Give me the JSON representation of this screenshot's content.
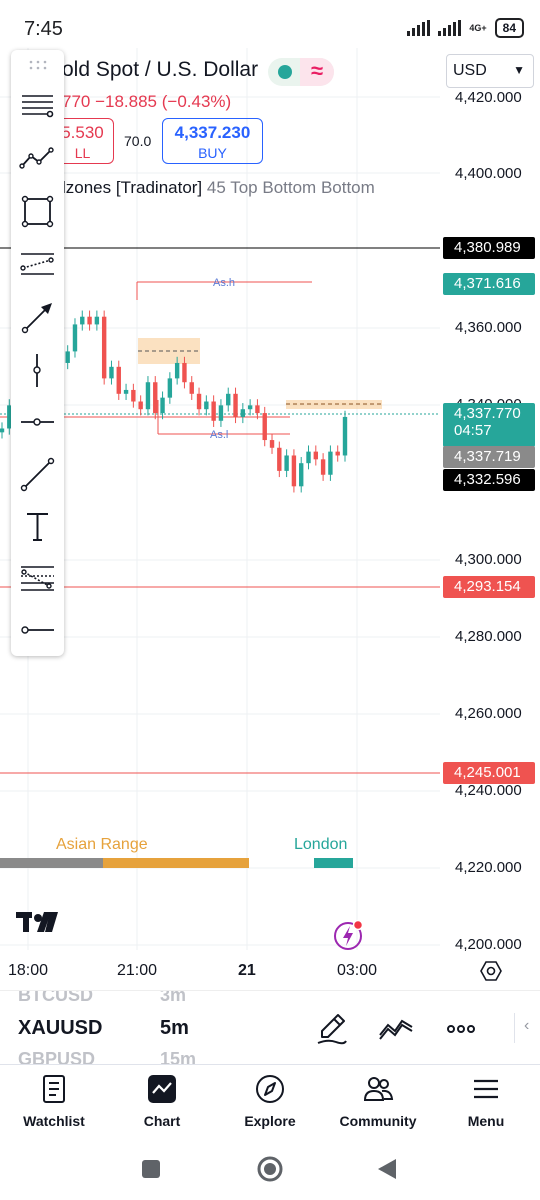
{
  "status_bar": {
    "time": "7:45",
    "network": "4G+",
    "battery": "84"
  },
  "header": {
    "symbol_title": "old Spot / U.S. Dollar",
    "change_text": "770  −18.885 (−0.43%)",
    "currency": "USD"
  },
  "trade": {
    "sell_price": "5.530",
    "sell_label": "LL",
    "spread": "70.0",
    "buy_price": "4,337.230",
    "buy_label": "BUY"
  },
  "indicator": {
    "name": "lzones [Tradinator]",
    "params": "45 Top Bottom Bottom"
  },
  "chart_annotations": {
    "asian_high": "As.h",
    "asian_low": "As.l"
  },
  "colors": {
    "up": "#26a69a",
    "down": "#ef5350",
    "grid": "#eef0f3",
    "zone": "#f8c98e",
    "asian_bar": "#e6a23c",
    "london": "#26a69a",
    "range_gray": "#8a8a8a"
  },
  "price_axis": {
    "ticks": [
      "4,420.000",
      "4,400.000",
      "4,360.000",
      "4,340.000",
      "4,300.000",
      "4,280.000",
      "4,260.000",
      "4,240.000",
      "4,220.000",
      "4,200.000"
    ],
    "tags": [
      {
        "text": "4,380.989",
        "bg": "#000000"
      },
      {
        "text": "4,371.616",
        "bg": "#26a69a"
      },
      {
        "text": "4,337.770",
        "sub": "04:57",
        "bg": "#26a69a"
      },
      {
        "text": "4,337.719",
        "bg": "#8a8a8a"
      },
      {
        "text": "4,332.596",
        "bg": "#000000"
      },
      {
        "text": "4,293.154",
        "bg": "#ef5350"
      },
      {
        "text": "4,245.001",
        "bg": "#ef5350"
      }
    ]
  },
  "sessions": {
    "asian": "Asian Range",
    "london": "London"
  },
  "time_axis": {
    "ticks": [
      "18:00",
      "21:00",
      "21",
      "03:00"
    ]
  },
  "chart_data": {
    "type": "candlestick",
    "x": [
      "18:00",
      "21:00",
      "21",
      "03:00"
    ],
    "ylim": [
      4200,
      4420
    ],
    "horizontal_levels": [
      4380.989,
      4371.616,
      4337.77,
      4332.596,
      4293.154,
      4245.001
    ],
    "last_price": 4337.77,
    "close_path": [
      4334,
      4340,
      4336,
      4347,
      4360,
      4362,
      4357,
      4354,
      4351,
      4354,
      4361,
      4363,
      4361,
      4363,
      4347,
      4350,
      4343,
      4344,
      4341,
      4339,
      4346,
      4338,
      4342,
      4347,
      4351,
      4346,
      4343,
      4339,
      4341,
      4336,
      4340,
      4343,
      4337,
      4339,
      4340,
      4338,
      4331,
      4329,
      4323,
      4327,
      4319,
      4325,
      4328,
      4326,
      4322,
      4328,
      4327,
      4337
    ]
  },
  "picker": {
    "symbol": "XAUUSD",
    "interval": "5m",
    "prev_symbol": "BTCUSD",
    "prev_interval": "3m",
    "next_symbol": "GBPUSD",
    "next_interval": "15m"
  },
  "bottom_nav": {
    "watchlist": "Watchlist",
    "chart": "Chart",
    "explore": "Explore",
    "community": "Community",
    "menu": "Menu"
  }
}
